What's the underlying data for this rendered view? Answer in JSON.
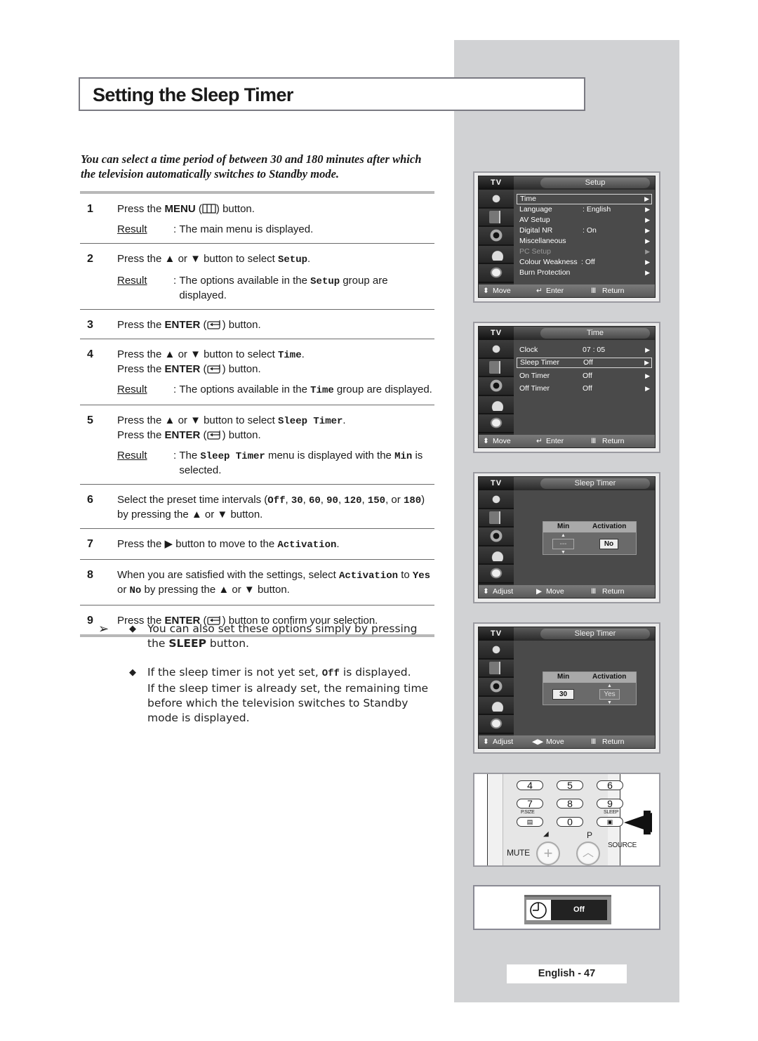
{
  "title": "Setting the Sleep Timer",
  "intro": "You can select a time period of between 30 and 180 minutes after which the television automatically switches to Standby mode.",
  "result_label": "Result",
  "steps": [
    {
      "num": "1",
      "lines": [
        "Press the MENU ( Ⅱ ) button."
      ],
      "result": "The main menu is displayed."
    },
    {
      "num": "2",
      "lines": [
        "Press the ▲ or ▼ button to select Setup."
      ],
      "result": "The options available in the Setup group are displayed."
    },
    {
      "num": "3",
      "lines": [
        "Press the ENTER ( ↵ ) button."
      ]
    },
    {
      "num": "4",
      "lines": [
        "Press the ▲ or ▼ button to select Time.",
        "Press the ENTER ( ↵ ) button."
      ],
      "result": "The options available in the Time group are displayed."
    },
    {
      "num": "5",
      "lines": [
        "Press the ▲ or ▼ button to select Sleep Timer.",
        "Press the ENTER ( ↵ ) button."
      ],
      "result": "The Sleep Timer menu is displayed with the Min is selected."
    },
    {
      "num": "6",
      "lines": [
        "Select the preset time intervals (Off, 30, 60, 90, 120, 150, or 180) by pressing the ▲ or ▼ button."
      ]
    },
    {
      "num": "7",
      "lines": [
        "Press the ▶ button to move to the Activation."
      ]
    },
    {
      "num": "8",
      "lines": [
        "When you are satisfied with the settings, select Activation to Yes or No by pressing the ▲ or ▼ button."
      ]
    },
    {
      "num": "9",
      "lines": [
        "Press the ENTER ( ↵ ) button to confirm your selection."
      ]
    }
  ],
  "text": {
    "press_the": "Press the",
    "menu": "MENU",
    "enter": "ENTER",
    "button": "button.",
    "or": "or",
    "button_to_select": "button to select",
    "s6a": "Select the preset time intervals (",
    "s6_vals": [
      "Off",
      "30",
      "60",
      "90",
      "120",
      "150",
      "180"
    ],
    "s6b": "by pressing the",
    "s7a": "button to move to the",
    "s8a": "When you are satisfied with the settings, select",
    "s8b": "to",
    "s8c": "by pressing the",
    "s9a": "button to confirm your selection.",
    "r1": "The main menu is displayed.",
    "r2a": "The options available in the",
    "r2b": "group are displayed.",
    "r4b": "group are displayed.",
    "r5a": "The",
    "r5b": "menu is displayed with the",
    "r5c": "is selected.",
    "setup": "Setup",
    "time": "Time",
    "sleep_timer": "Sleep Timer",
    "activation": "Activation",
    "min": "Min",
    "yes": "Yes",
    "no": "No"
  },
  "notes": {
    "arrow": "➢",
    "diamond": "◆",
    "n1a": "You can also set these options simply by pressing the",
    "n1b": "SLEEP",
    "n1c": "button.",
    "n2a": "If the sleep timer is not yet set,",
    "n2b": "Off",
    "n2c": "is displayed.",
    "n2d": "If the sleep timer is already set, the remaining time before which the television switches to Standby mode is displayed."
  },
  "screens": {
    "tv_label": "TV",
    "setup": {
      "title": "Setup",
      "items": [
        {
          "label": "Time",
          "value": "",
          "selected": true
        },
        {
          "label": "Language",
          "value": ":  English"
        },
        {
          "label": "AV Setup",
          "value": ""
        },
        {
          "label": "Digital NR",
          "value": ":  On"
        },
        {
          "label": "Miscellaneous",
          "value": ""
        },
        {
          "label": "PC Setup",
          "value": "",
          "disabled": true
        },
        {
          "label": "Colour Weakness",
          "value": ":  Off"
        },
        {
          "label": "Burn Protection",
          "value": ""
        }
      ],
      "footer": [
        "Move",
        "Enter",
        "Return"
      ]
    },
    "time": {
      "title": "Time",
      "items": [
        {
          "label": "Clock",
          "value": "07 : 05"
        },
        {
          "label": "Sleep Timer",
          "value": "Off",
          "selected": true
        },
        {
          "label": "On Timer",
          "value": "Off"
        },
        {
          "label": "Off Timer",
          "value": "Off"
        }
      ],
      "footer": [
        "Move",
        "Enter",
        "Return"
      ]
    },
    "sleep1": {
      "title": "Sleep Timer",
      "min_label": "Min",
      "activation_label": "Activation",
      "min_value": "---",
      "activation_value": "No",
      "footer": [
        "Adjust",
        "Move",
        "Return"
      ]
    },
    "sleep2": {
      "title": "Sleep Timer",
      "min_label": "Min",
      "activation_label": "Activation",
      "min_value": "30",
      "activation_value": "Yes",
      "footer": [
        "Adjust",
        "Move",
        "Return"
      ]
    }
  },
  "remote": {
    "keys": [
      "4",
      "5",
      "6",
      "7",
      "8",
      "9",
      "0"
    ],
    "psize": "P.SIZE",
    "sleep": "SLEEP",
    "mute": "MUTE",
    "p": "P",
    "source": "SOURCE"
  },
  "osd": {
    "value": "Off"
  },
  "page_number": "English - 47"
}
